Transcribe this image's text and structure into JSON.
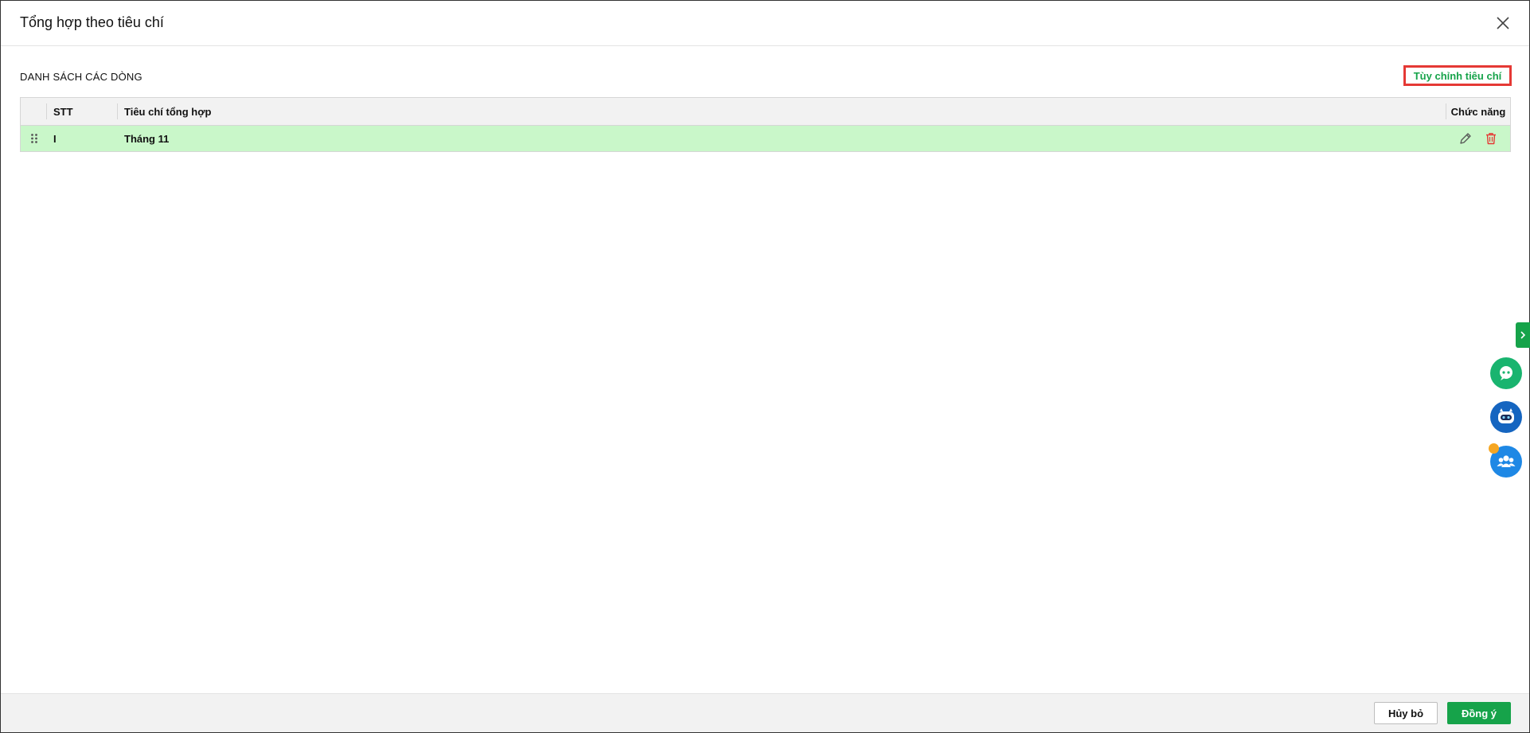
{
  "dialog": {
    "title": "Tổng hợp theo tiêu chí",
    "close_icon": "close-icon"
  },
  "section": {
    "title": "DANH SÁCH CÁC DÒNG",
    "customize_link": "Tùy chỉnh tiêu chí"
  },
  "grid": {
    "columns": {
      "stt": "STT",
      "criteria": "Tiêu chí tổng hợp",
      "actions": "Chức năng"
    },
    "rows": [
      {
        "stt": "I",
        "criteria": "Tháng 11",
        "selected": true
      }
    ],
    "row_icons": [
      "drag-handle-icon",
      "edit-pencil-icon",
      "delete-trash-icon"
    ],
    "row_highlight_color": "#c9f7c9"
  },
  "footer": {
    "cancel_label": "Hủy bỏ",
    "ok_label": "Đồng ý"
  },
  "floating": {
    "icons": [
      "chevron-right-icon",
      "chat-bubble-icon",
      "robot-assistant-icon",
      "team-group-icon"
    ]
  },
  "colors": {
    "accent_green": "#16a34a",
    "highlight_border": "#e53935",
    "notification": "#f5a623"
  }
}
